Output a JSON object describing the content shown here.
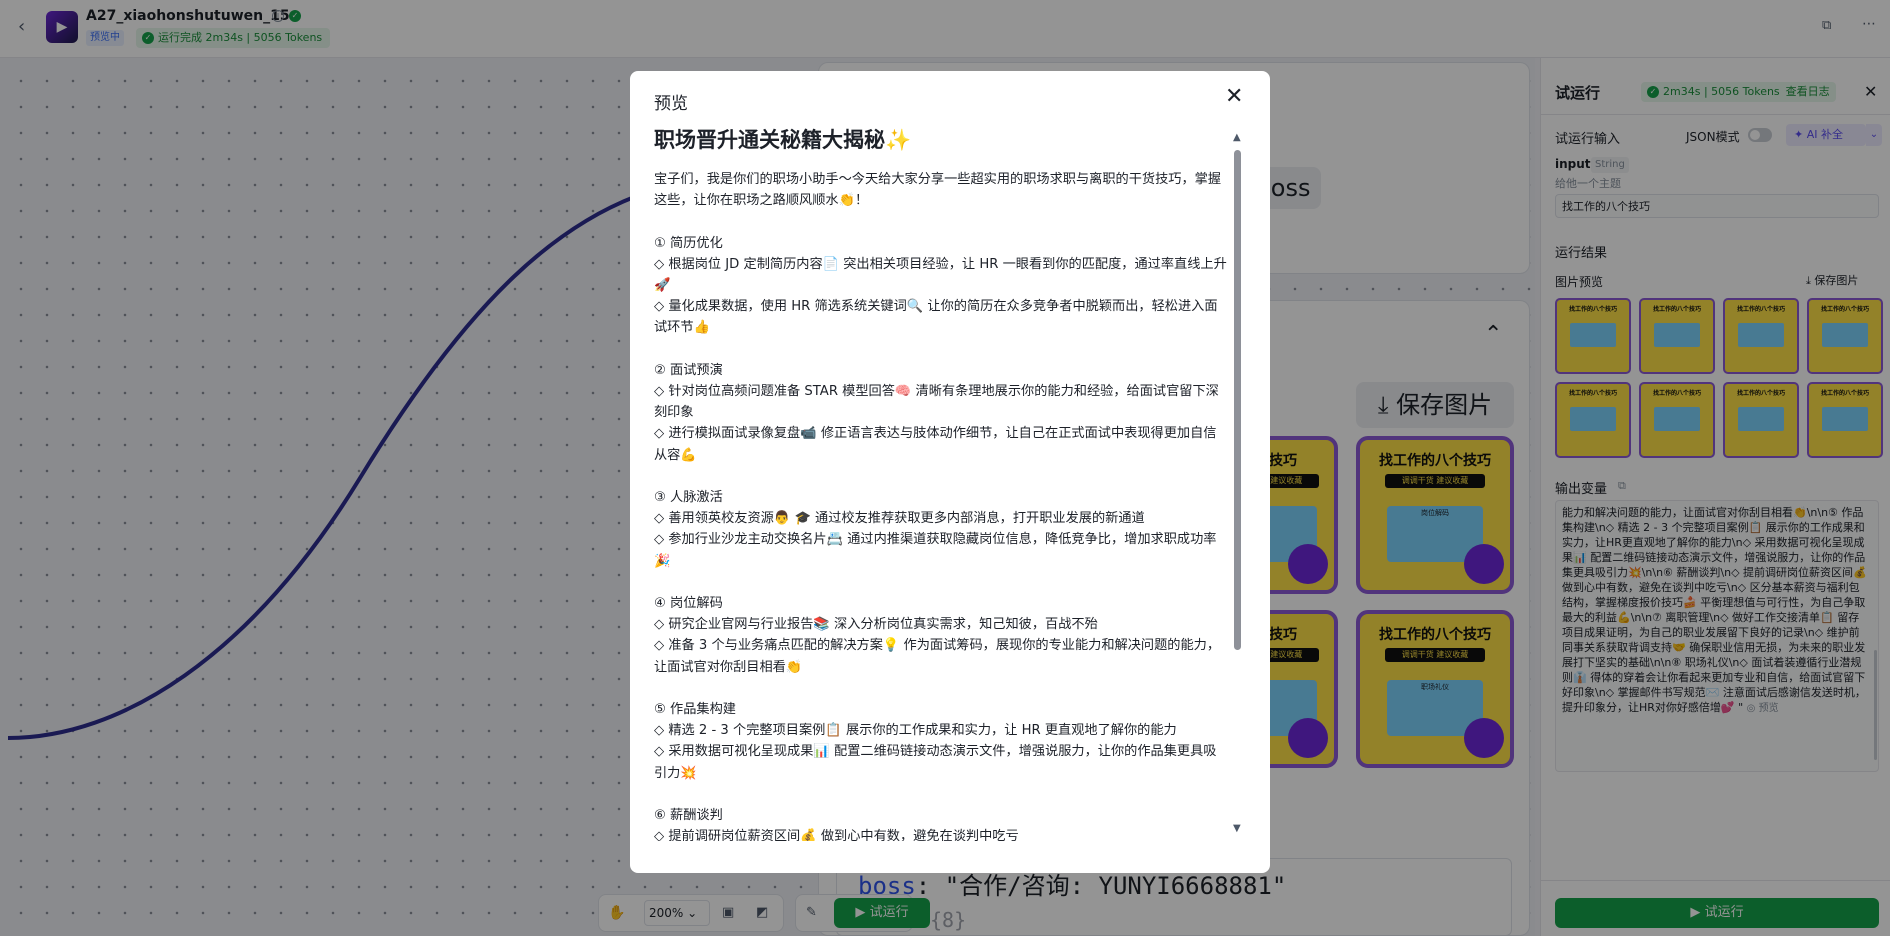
{
  "header": {
    "back_icon": "chevron-left-icon",
    "app_name": "A27_xiaohonshutuwen_15",
    "preview_badge": "预览中",
    "run_status": "运行完成 2m34s | 5056 Tokens"
  },
  "canvas": {
    "boss_label": "boss",
    "save_image_label": "保存图片",
    "poster_title": "找工作的八个技巧",
    "poster_title_partial": "八个技巧",
    "poster_sub": "调调干货 建议收藏",
    "poster_section_1": "岗位解码",
    "poster_section_2": "职场礼仪",
    "code_key": "boss",
    "code_value": ": \"合作/咨询: YUNYI6668881\"",
    "code_next": "{8}",
    "zoom_level": "200%",
    "run_label": "试运行"
  },
  "right_panel": {
    "title": "试运行",
    "status": "2m34s | 5056 Tokens",
    "view_log": "查看日志",
    "section_input": "试运行输入",
    "json_mode": "JSON模式",
    "ai_fill": "AI 补全",
    "input_name": "input",
    "input_type": "String",
    "input_hint": "给他一个主题",
    "input_value": "找工作的八个技巧",
    "section_result": "运行结果",
    "image_preview": "图片预览",
    "save_image": "保存图片",
    "thumb_title": "找工作的八个技巧",
    "output_var": "输出变量",
    "output_text": "能力和解决问题的能力，让面试官对你刮目相看👏\\n\\n⑤ 作品集构建\\n◇ 精选 2 - 3 个完整项目案例📋 展示你的工作成果和实力，让HR更直观地了解你的能力\\n◇ 采用数据可视化呈现成果📊 配置二维码链接动态演示文件，增强说服力，让你的作品集更具吸引力💥\\n\\n⑥ 薪酬谈判\\n◇ 提前调研岗位薪资区间💰 做到心中有数，避免在谈判中吃亏\\n◇ 区分基本薪资与福利包结构，掌握梯度报价技巧🍰 平衡理想值与可行性，为自己争取最大的利益💪\\n\\n⑦ 离职管理\\n◇ 做好工作交接清单📋 留存项目成果证明，为自己的职业发展留下良好的记录\\n◇ 维护前同事关系获取背调支持🤝 确保职业信用无损，为未来的职业发展打下坚实的基础\\n\\n⑧ 职场礼仪\\n◇ 面试着装遵循行业潜规则👔 得体的穿着会让你看起来更加专业和自信，给面试官留下好印象\\n◇ 掌握邮件书写规范✉️ 注意面试后感谢信发送时机，提升印象分，让HR对你好感倍增💕 \"",
    "output_preview": "◎ 预览",
    "run_button": "试运行"
  },
  "modal": {
    "title": "预览",
    "doc_title": "职场晋升通关秘籍大揭秘✨",
    "lines": [
      "宝子们，我是你们的职场小助手～今天给大家分享一些超实用的职场求职与离职的干货技巧，掌握这些，让你在职场之路顺风顺水👏！",
      "",
      "① 简历优化",
      "◇ 根据岗位 JD 定制简历内容📄 突出相关项目经验，让 HR 一眼看到你的匹配度，通过率直线上升🚀",
      "◇ 量化成果数据，使用 HR 筛选系统关键词🔍 让你的简历在众多竞争者中脱颖而出，轻松进入面试环节👍",
      "",
      "② 面试预演",
      "◇ 针对岗位高频问题准备 STAR 模型回答🧠 清晰有条理地展示你的能力和经验，给面试官留下深刻印象",
      "◇ 进行模拟面试录像复盘📹 修正语言表达与肢体动作细节，让自己在正式面试中表现得更加自信从容💪",
      "",
      "③ 人脉激活",
      "◇ 善用领英校友资源👨 🎓 通过校友推荐获取更多内部消息，打开职业发展的新通道",
      "◇ 参加行业沙龙主动交换名片📇 通过内推渠道获取隐藏岗位信息，降低竞争比，增加求职成功率🎉",
      "",
      "④ 岗位解码",
      "◇ 研究企业官网与行业报告📚 深入分析岗位真实需求，知己知彼，百战不殆",
      "◇ 准备 3 个与业务痛点匹配的解决方案💡 作为面试筹码，展现你的专业能力和解决问题的能力，让面试官对你刮目相看👏",
      "",
      "⑤ 作品集构建",
      "◇ 精选 2 - 3 个完整项目案例📋 展示你的工作成果和实力，让 HR 更直观地了解你的能力",
      "◇ 采用数据可视化呈现成果📊 配置二维码链接动态演示文件，增强说服力，让你的作品集更具吸引力💥",
      "",
      "⑥ 薪酬谈判",
      "◇ 提前调研岗位薪资区间💰 做到心中有数，避免在谈判中吃亏"
    ],
    "close_icon": "close-icon"
  },
  "colors": {
    "accent_green": "#16a34a",
    "poster_purple": "#8c5ad6",
    "poster_yellow": "#fde047",
    "curve_blue": "#2e2d8f"
  }
}
